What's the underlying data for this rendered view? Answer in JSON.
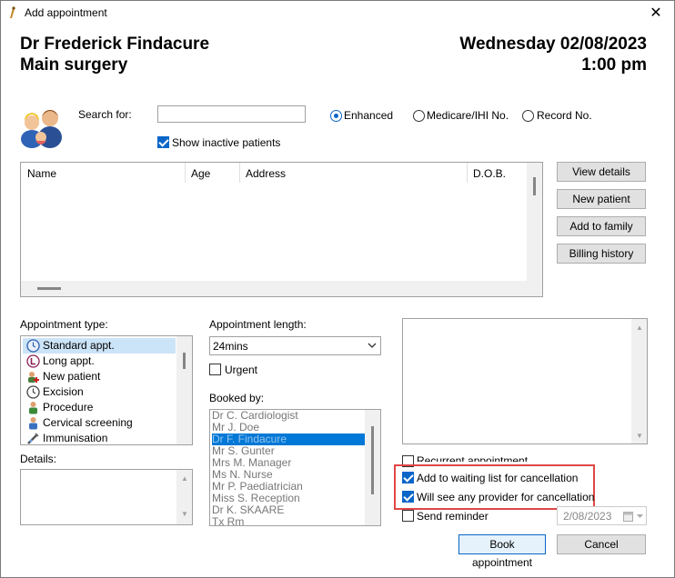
{
  "window": {
    "title": "Add appointment",
    "close_glyph": "✕"
  },
  "header": {
    "doctor": "Dr Frederick Findacure",
    "location": "Main surgery",
    "date": "Wednesday 02/08/2023",
    "time": "1:00 pm"
  },
  "search": {
    "label": "Search for:",
    "value": "",
    "modes": [
      {
        "label": "Enhanced",
        "selected": true
      },
      {
        "label": "Medicare/IHI No.",
        "selected": false
      },
      {
        "label": "Record No.",
        "selected": false
      }
    ],
    "show_inactive_label": "Show inactive patients",
    "show_inactive_checked": true,
    "icon": "patients-family-icon"
  },
  "results_grid": {
    "columns": [
      "Name",
      "Age",
      "Address",
      "D.O.B."
    ],
    "rows": []
  },
  "side_buttons": [
    "View details",
    "New patient",
    "Add to family",
    "Billing history"
  ],
  "appointment_type": {
    "label": "Appointment type:",
    "items": [
      {
        "label": "Standard appt.",
        "icon": "clock-icon",
        "selected": true
      },
      {
        "label": "Long appt.",
        "icon": "long-appt-icon",
        "selected": false
      },
      {
        "label": "New patient",
        "icon": "new-patient-icon",
        "selected": false
      },
      {
        "label": "Excision",
        "icon": "clock-icon",
        "selected": false
      },
      {
        "label": "Procedure",
        "icon": "procedure-icon",
        "selected": false
      },
      {
        "label": "Cervical screening",
        "icon": "person-icon",
        "selected": false
      },
      {
        "label": "Immunisation",
        "icon": "syringe-icon",
        "selected": false
      }
    ]
  },
  "details": {
    "label": "Details:",
    "value": ""
  },
  "appointment_length": {
    "label": "Appointment length:",
    "value": "24mins",
    "urgent_label": "Urgent",
    "urgent_checked": false
  },
  "booked_by": {
    "label": "Booked by:",
    "items": [
      "Dr C. Cardiologist",
      "Mr J. Doe",
      "Dr F. Findacure",
      "Mr S. Gunter",
      "Mrs M. Manager",
      "Ms N. Nurse",
      "Mr P. Paediatrician",
      "Miss S. Reception",
      "Dr K. SKAARE",
      "Tx Rm"
    ],
    "selected_index": 2
  },
  "options": {
    "recurrent_label": "Recurrent appointment",
    "recurrent_checked": false,
    "waiting_list_label": "Add to waiting list for cancellation",
    "waiting_list_checked": true,
    "any_provider_label": "Will see any provider for cancellation",
    "any_provider_checked": true,
    "send_reminder_label": "Send reminder",
    "send_reminder_checked": false,
    "reminder_date": "2/08/2023"
  },
  "footer": {
    "book_label": "Book appointment",
    "cancel_label": "Cancel"
  },
  "colors": {
    "accent": "#0a66c8",
    "highlight": "#e04646",
    "selection": "#0078d7"
  }
}
